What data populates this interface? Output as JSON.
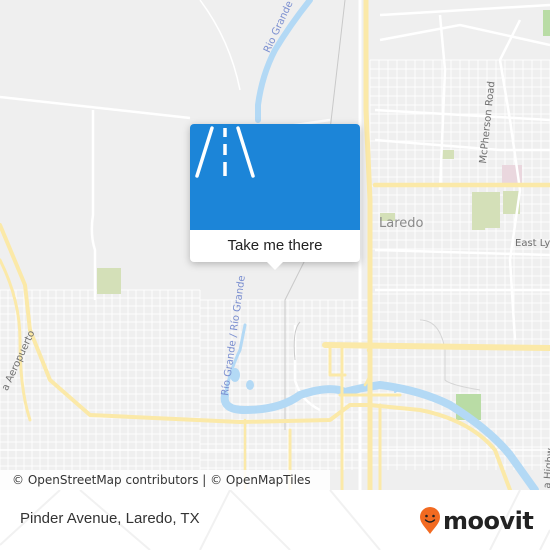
{
  "map": {
    "labels": {
      "rio_grande_north": "Rio Grande",
      "rio_grande_south": "Río Grande / Río Grande",
      "mcpherson_road": "McPherson Road",
      "laredo": "Laredo",
      "east_ly": "East Ly",
      "aeropuerto": "a Aeropuerto",
      "highway": "a Highw"
    },
    "colors": {
      "background": "#efefef",
      "street": "#ffffff",
      "major_road": "#fbe9a8",
      "water": "#b3d9f5",
      "park": "#d4e0b8",
      "commercial": "#ead7de"
    }
  },
  "attribution": {
    "text": "© OpenStreetMap contributors | © OpenMapTiles"
  },
  "popup": {
    "icon": "road-icon",
    "button_label": "Take me there",
    "color": "#1c85d8"
  },
  "footer": {
    "location_title": "Pinder Avenue, Laredo, TX",
    "brand": "moovit",
    "brand_color": "#f26a21"
  }
}
